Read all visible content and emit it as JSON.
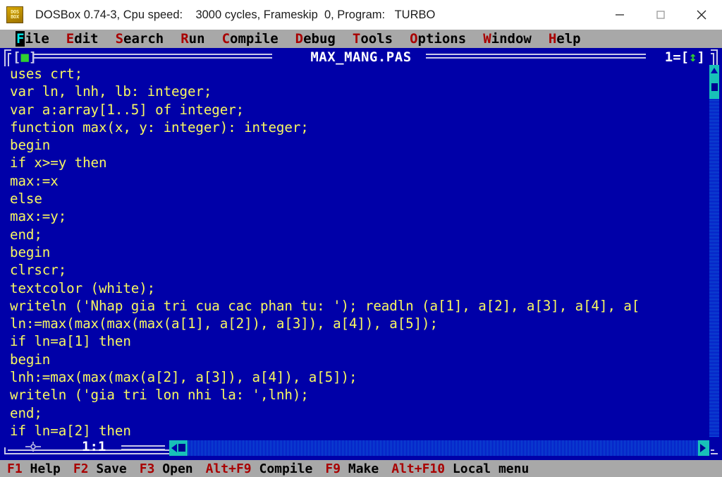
{
  "window": {
    "icon_name": "dosbox-icon",
    "icon_line1": "DOS",
    "icon_line2": "BOX",
    "title": "DOSBox 0.74-3, Cpu speed:    3000 cycles, Frameskip  0, Program:   TURBO",
    "controls": {
      "minimize": "minimize-icon",
      "maximize": "maximize-icon",
      "close": "close-icon"
    }
  },
  "menubar": {
    "items": [
      {
        "hot": "F",
        "rest": "ile"
      },
      {
        "hot": "E",
        "rest": "dit"
      },
      {
        "hot": "S",
        "rest": "earch"
      },
      {
        "hot": "R",
        "rest": "un"
      },
      {
        "hot": "C",
        "rest": "ompile"
      },
      {
        "hot": "D",
        "rest": "ebug"
      },
      {
        "hot": "T",
        "rest": "ools"
      },
      {
        "hot": "O",
        "rest": "ptions"
      },
      {
        "hot": "W",
        "rest": "indow"
      },
      {
        "hot": "H",
        "rest": "elp"
      }
    ]
  },
  "editor": {
    "title": "MAX_MANG.PAS",
    "close_box_left": "[",
    "close_box_sq": "■",
    "close_box_right": "]",
    "window_number": "1",
    "zoom_prefix": "=[",
    "zoom_arrow": "↕",
    "zoom_suffix": "]",
    "cursor_position": "1:1",
    "resize_glyph": "──┼──",
    "lines": [
      "uses crt;",
      "var ln, lnh, lb: integer;",
      "var a:array[1..5] of integer;",
      "function max(x, y: integer): integer;",
      "begin",
      "if x>=y then",
      "max:=x",
      "else",
      "max:=y;",
      "end;",
      "begin",
      "clrscr;",
      "textcolor (white);",
      "writeln ('Nhap gia tri cua cac phan tu: '); readln (a[1], a[2], a[3], a[4], a[",
      "ln:=max(max(max(max(a[1], a[2]), a[3]), a[4]), a[5]);",
      "if ln=a[1] then",
      "begin",
      "lnh:=max(max(max(a[2], a[3]), a[4]), a[5]);",
      "writeln ('gia tri lon nhi la: ',lnh);",
      "end;",
      "if ln=a[2] then"
    ]
  },
  "statusbar": {
    "keys": [
      {
        "key": "F1",
        "label": " Help"
      },
      {
        "key": "F2",
        "label": " Save"
      },
      {
        "key": "F3",
        "label": " Open"
      },
      {
        "key": "Alt+F9",
        "label": " Compile"
      },
      {
        "key": "F9",
        "label": " Make"
      },
      {
        "key": "Alt+F10",
        "label": " Local menu"
      }
    ]
  },
  "colors": {
    "dos_blue": "#0000a8",
    "code_yellow": "#f8f860",
    "menu_gray": "#a8a8a8",
    "hotkey_red": "#a80000",
    "frame_white": "#c8c8e8",
    "scroll_cyan": "#18c0b8",
    "green_marker": "#30d030"
  }
}
